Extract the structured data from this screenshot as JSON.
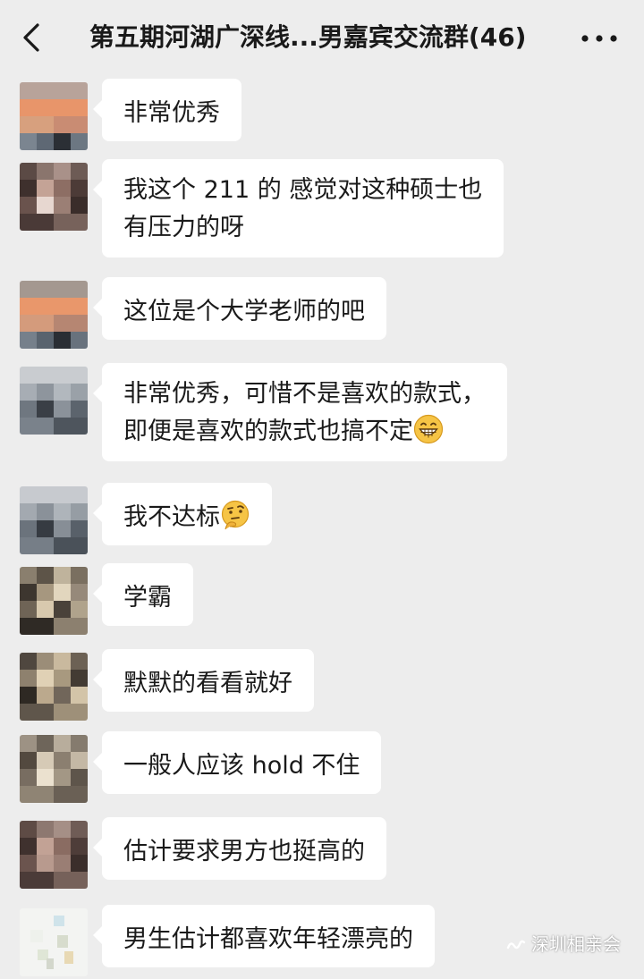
{
  "header": {
    "title": "第五期河湖广深线...男嘉宾交流群(46)",
    "back_icon": "chevron-left-icon",
    "more_icon": "more-horizontal-icon"
  },
  "messages": [
    {
      "lines": [
        "非常优秀"
      ],
      "emoji": null
    },
    {
      "lines": [
        "我这个 211 的 感觉对这种硕士也",
        "有压力的呀"
      ],
      "emoji": null
    },
    {
      "lines": [
        "这位是个大学老师的吧"
      ],
      "emoji": null
    },
    {
      "lines": [
        "非常优秀，可惜不是喜欢的款式，",
        "即便是喜欢的款式也搞不定"
      ],
      "emoji": "grin-emoji"
    },
    {
      "lines": [
        "我不达标"
      ],
      "emoji": "thinking-emoji"
    },
    {
      "lines": [
        "学霸"
      ],
      "emoji": null
    },
    {
      "lines": [
        "默默的看看就好"
      ],
      "emoji": null
    },
    {
      "lines": [
        "一般人应该 hold 不住"
      ],
      "emoji": null
    },
    {
      "lines": [
        "估计要求男方也挺高的"
      ],
      "emoji": null
    },
    {
      "lines": [
        "男生估计都喜欢年轻漂亮的"
      ],
      "emoji": null
    }
  ],
  "watermark": {
    "text": "深圳相亲会",
    "icon": "wechat-channel-icon"
  },
  "colors": {
    "background": "#ededed",
    "bubble": "#ffffff",
    "text": "#1a1a1a"
  }
}
